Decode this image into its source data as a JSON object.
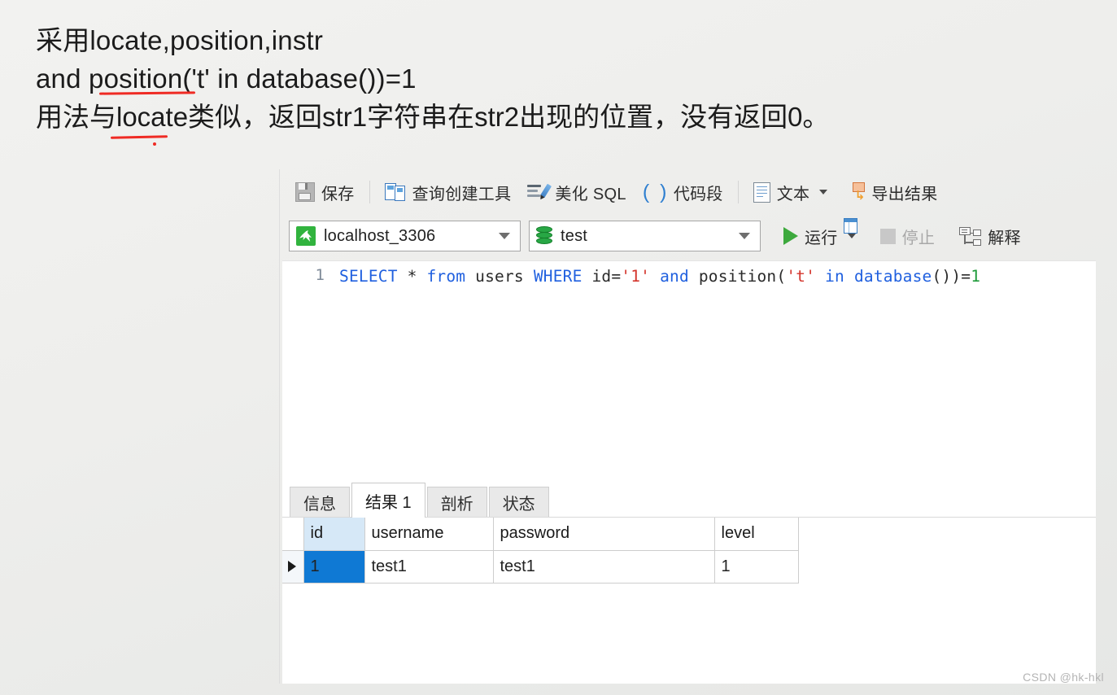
{
  "note": {
    "line1": "采用locate,position,instr",
    "line2": "and position('t' in database())=1",
    "line3": "用法与locate类似，返回str1字符串在str2出现的位置，没有返回0。"
  },
  "toolbar": {
    "save_label": "保存",
    "query_builder_label": "查询创建工具",
    "beautify_sql_label": "美化 SQL",
    "snippet_label": "代码段",
    "snippet_glyph": "( )",
    "text_label": "文本",
    "export_label": "导出结果",
    "export_arrow_glyph": "↳"
  },
  "connection": {
    "server_value": "localhost_3306",
    "database_value": "test",
    "run_label": "运行",
    "stop_label": "停止",
    "explain_label": "解释"
  },
  "editor": {
    "line_number": "1",
    "tokens": [
      {
        "t": "SELECT",
        "c": "kw"
      },
      {
        "t": " * ",
        "c": "op"
      },
      {
        "t": "from",
        "c": "kw"
      },
      {
        "t": " users ",
        "c": "id"
      },
      {
        "t": "WHERE",
        "c": "kw"
      },
      {
        "t": " id=",
        "c": "id"
      },
      {
        "t": "'1'",
        "c": "str"
      },
      {
        "t": " ",
        "c": "id"
      },
      {
        "t": "and",
        "c": "kw"
      },
      {
        "t": " position(",
        "c": "fn"
      },
      {
        "t": "'t'",
        "c": "str"
      },
      {
        "t": " ",
        "c": "id"
      },
      {
        "t": "in",
        "c": "kw"
      },
      {
        "t": " ",
        "c": "id"
      },
      {
        "t": "database",
        "c": "kw"
      },
      {
        "t": "())=",
        "c": "op"
      },
      {
        "t": "1",
        "c": "num"
      }
    ],
    "full_sql": "SELECT * from users WHERE id='1' and position('t' in database())=1"
  },
  "results": {
    "tabs": [
      {
        "label": "信息",
        "active": false
      },
      {
        "label": "结果 1",
        "active": true
      },
      {
        "label": "剖析",
        "active": false
      },
      {
        "label": "状态",
        "active": false
      }
    ],
    "columns": [
      "id",
      "username",
      "password",
      "level"
    ],
    "rows": [
      {
        "id": "1",
        "username": "test1",
        "password": "test1",
        "level": "1"
      }
    ]
  },
  "watermark": "CSDN @hk-hkl",
  "colors": {
    "accent_green": "#31b33e",
    "select_blue": "#0f79d4",
    "header_select_blue": "#d6e8f7",
    "underline_red": "#ef2b24",
    "keyword_blue": "#2060df",
    "string_red": "#d4352c",
    "number_green": "#1f9b3b"
  }
}
